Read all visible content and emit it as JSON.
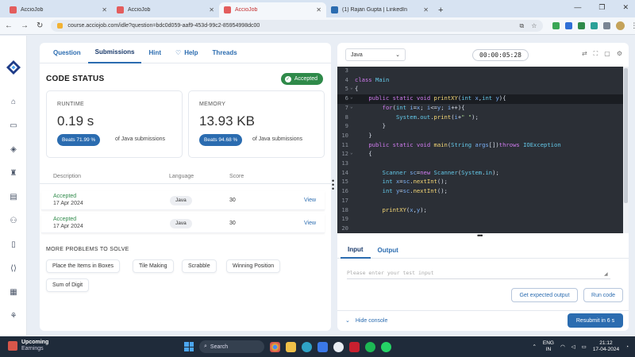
{
  "browser": {
    "tabs": [
      {
        "title": "AccioJob",
        "active": false,
        "color": "#e35d5d"
      },
      {
        "title": "AccioJob",
        "active": false,
        "color": "#e35d5d"
      },
      {
        "title": "AccioJob",
        "active": true,
        "color": "#e35d5d"
      },
      {
        "title": "(1) Rajan Gupta | LinkedIn",
        "active": false,
        "color": "#2b6cb0"
      }
    ],
    "new_tab": "+",
    "url": "course.acciojob.com/idle?question=bdc0d059-aaf9-453d-99c2-85954998dc00"
  },
  "left_panel": {
    "tabs": [
      {
        "label": "Question",
        "active": false
      },
      {
        "label": "Submissions",
        "active": true
      },
      {
        "label": "Hint",
        "active": false
      },
      {
        "label": "Help",
        "active": false
      },
      {
        "label": "Threads",
        "active": false
      }
    ],
    "code_status_title": "CODE STATUS",
    "status_badge": "Accepted",
    "runtime": {
      "label": "RUNTIME",
      "value": "0.19 s",
      "beats": "Beats 71.99 %",
      "suffix": "of Java submissions"
    },
    "memory": {
      "label": "MEMORY",
      "value": "13.93 KB",
      "beats": "Beats 94.68 %",
      "suffix": "of Java submissions"
    },
    "table": {
      "headers": [
        "Description",
        "Language",
        "Score"
      ],
      "rows": [
        {
          "status": "Accepted",
          "date": "17 Apr 2024",
          "language": "Java",
          "score": "30",
          "action": "View"
        },
        {
          "status": "Accepted",
          "date": "17 Apr 2024",
          "language": "Java",
          "score": "30",
          "action": "View"
        }
      ]
    },
    "more_problems_title": "MORE PROBLEMS TO SOLVE",
    "problems": [
      "Place the Items in Boxes",
      "Tile Making",
      "Scrabble",
      "Winning Position",
      "Sum of Digit"
    ]
  },
  "editor": {
    "language": "Java",
    "timer": "00:00:05:28",
    "line_numbers": [
      "3",
      "4",
      "5",
      "6",
      "7",
      "8",
      "9",
      "10",
      "11",
      "12",
      "13",
      "14",
      "15",
      "16",
      "17",
      "18",
      "19",
      "20"
    ],
    "io_tabs": [
      {
        "label": "Input",
        "active": true
      },
      {
        "label": "Output",
        "active": false
      }
    ],
    "input_placeholder": "Please enter your test input",
    "get_expected_output": "Get expected output",
    "run_code": "Run code",
    "hide_console": "Hide console",
    "resubmit": "Resubmit in 6 s"
  },
  "taskbar": {
    "weather_title": "Upcoming",
    "weather_sub": "Earnings",
    "search_label": "Search",
    "lang_top": "ENG",
    "lang_bottom": "IN",
    "time": "21:12",
    "date": "17-04-2024"
  }
}
